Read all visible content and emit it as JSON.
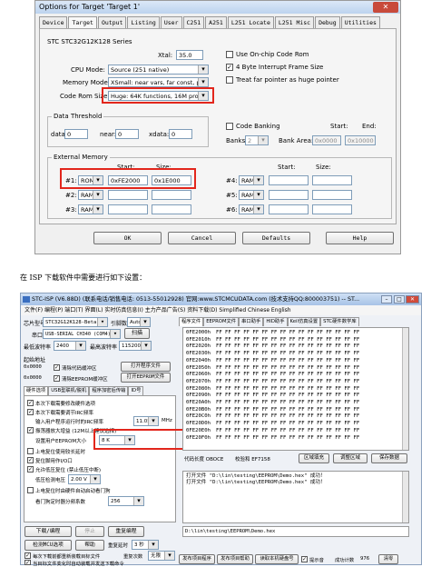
{
  "dialog": {
    "title": "Options for Target 'Target 1'",
    "close": "✕",
    "tabs": [
      "Device",
      "Target",
      "Output",
      "Listing",
      "User",
      "C251",
      "A251",
      "L251 Locate",
      "L251 Misc",
      "Debug",
      "Utilities"
    ],
    "device": "STC STC32G12K128 Series",
    "xtal_label": "Xtal:",
    "xtal": "35.0",
    "cpu_mode_label": "CPU Mode:",
    "cpu_mode": "Source (251 native)",
    "memory_model_label": "Memory Model:",
    "memory_model": "XSmall: near vars, far const, ptr-4",
    "code_rom_label": "Code Rom Size:",
    "code_rom": "Huge: 64K functions, 16M progr.",
    "opt_onchip": "Use On-chip Code Rom",
    "opt_interrupt": "4 Byte Interrupt Frame Size",
    "opt_treatfar": "Treat far pointer as huge pointer",
    "data_threshold_title": "Data Threshold",
    "data_label": "data:",
    "data_val": "0",
    "near_label": "near:",
    "near_val": "0",
    "xdata_label": "xdata:",
    "xdata_val": "0",
    "code_banking": "Code Banking",
    "banks_label": "Banks:",
    "banks_val": "2",
    "bank_area_label": "Bank Area:",
    "start_label": "Start:",
    "end_label": "End:",
    "size_label": "Size:",
    "bank_start": "0x0000",
    "bank_end": "0x10000",
    "ext_memory_title": "External Memory",
    "mem": [
      {
        "n": "#1:",
        "t": "ROM",
        "start": "0xFE2000",
        "size": "0x1E000"
      },
      {
        "n": "#2:",
        "t": "RAM",
        "start": "",
        "size": ""
      },
      {
        "n": "#3:",
        "t": "RAM",
        "start": "",
        "size": ""
      },
      {
        "n": "#4:",
        "t": "RAM",
        "start": "",
        "size": ""
      },
      {
        "n": "#5:",
        "t": "RAM",
        "start": "",
        "size": ""
      },
      {
        "n": "#6:",
        "t": "RAM",
        "start": "",
        "size": ""
      }
    ],
    "ok": "OK",
    "cancel": "Cancel",
    "defaults": "Defaults",
    "help": "Help"
  },
  "caption": "在 ISP 下载软件中需要进行如下设置：",
  "isp": {
    "title": "STC-ISP (V6.88D) (联系电话/销售电话: 0513-55012928) 官网:www.STCMCUDATA.com (技术支持QQ:800003751) -- ST...",
    "menu": "文件(F)  编程(P)  端口(T)  界面(L)  实时仿真信息(I)  主力产品广告(S)  资料下载(D)  Simplified Chinese  English",
    "chip_label": "芯片型号",
    "chip": "STC32G12K128-Beta",
    "pins_label": "引脚数",
    "pins": "Auto",
    "port_label": "串口",
    "port": "USB-SERIAL CH340 (COM4)",
    "scan": "扫描",
    "min_baud_label": "最低波特率",
    "min_baud": "2400",
    "max_baud_label": "最高波特率",
    "max_baud": "115200",
    "start_addr_label": "起始地址",
    "addr1": "0x0000",
    "clear_code": "清除代码缓冲区",
    "open_prog": "打开程序文件",
    "addr2": "0x0000",
    "clear_eeprom": "清除EEPROM缓冲区",
    "open_eeprom": "打开EEPROM文件",
    "hw_tabs": [
      "硬件选项",
      "USB型联机/脱机",
      "程序加密后传输",
      "ID号"
    ],
    "hw_opts": [
      "本次下载需要修改硬件选项",
      "本次下载需要调节IRC频率",
      "输入用户程序运行时的IRC频率",
      "振荡器放大增益 (12M以上建议选择)",
      "设置用户EEPROM大小",
      "上电复位使用较长延时",
      "复位脚用作I/O口",
      "允许低压复位 (禁止低压中断)",
      "低压检测电压",
      "上电复位时由硬件自动启动看门狗",
      "看门狗定时器分频系数"
    ],
    "irc_freq": "11.0592",
    "mhz": "MHz",
    "eeprom_size": "8 K",
    "lvd": "2.00 V",
    "wdt_div": "256",
    "download_btn": "下载/编程",
    "stop_btn": "停止",
    "reprogram_btn": "重复编程",
    "detect_btn": "检测MCU选项",
    "help_btn": "帮助",
    "repeat_delay_label": "重复延时",
    "repeat_delay": "3 秒",
    "opt_reload": "每次下载前都重新装载目标文件",
    "repeat_count_label": "重复次数",
    "repeat_count": "无限",
    "opt_auto": "当目标文件变化时自动装载并发送下载命令",
    "right_tabs": [
      "程序文件",
      "EEPROM文件",
      "串口助手",
      "HID助手",
      "Keil仿真设置",
      "STC硬件数学库"
    ],
    "hex_rows": [
      "0FE2000h",
      "0FE2010h",
      "0FE2020h",
      "0FE2030h",
      "0FE2040h",
      "0FE2050h",
      "0FE2060h",
      "0FE2070h",
      "0FE2080h",
      "0FE2090h",
      "0FE20A0h",
      "0FE20B0h",
      "0FE20C0h",
      "0FE20D0h",
      "0FE20E0h",
      "0FE20F0h"
    ],
    "hex_bytes": "FF FF FF FF FF FF FF FF FF FF FF FF FF FF FF FF",
    "checksum_label": "代码长度 OBOCE",
    "checksum_val": "校验和 EF7158",
    "fill_btn": "区域填充",
    "adjust_btn": "调整区域",
    "save_btn": "保存数据",
    "log1": "打开文件 \"D:\\lin\\testing\\EEPROM\\Demo.hex\" 成功！",
    "log2": "打开文件 \"D:\\lin\\testing\\EEPROM\\Demo.hex\" 成功！",
    "path": "D:\\lin\\testing\\EEPROM\\Demo.hex",
    "publish_prog": "发布项目程序",
    "publish_help": "发布项目帮助",
    "read_serial": "读取本机硬盘号",
    "beep": "提示音",
    "success_label": "成功计数",
    "success_count": "976",
    "clear": "清零"
  }
}
